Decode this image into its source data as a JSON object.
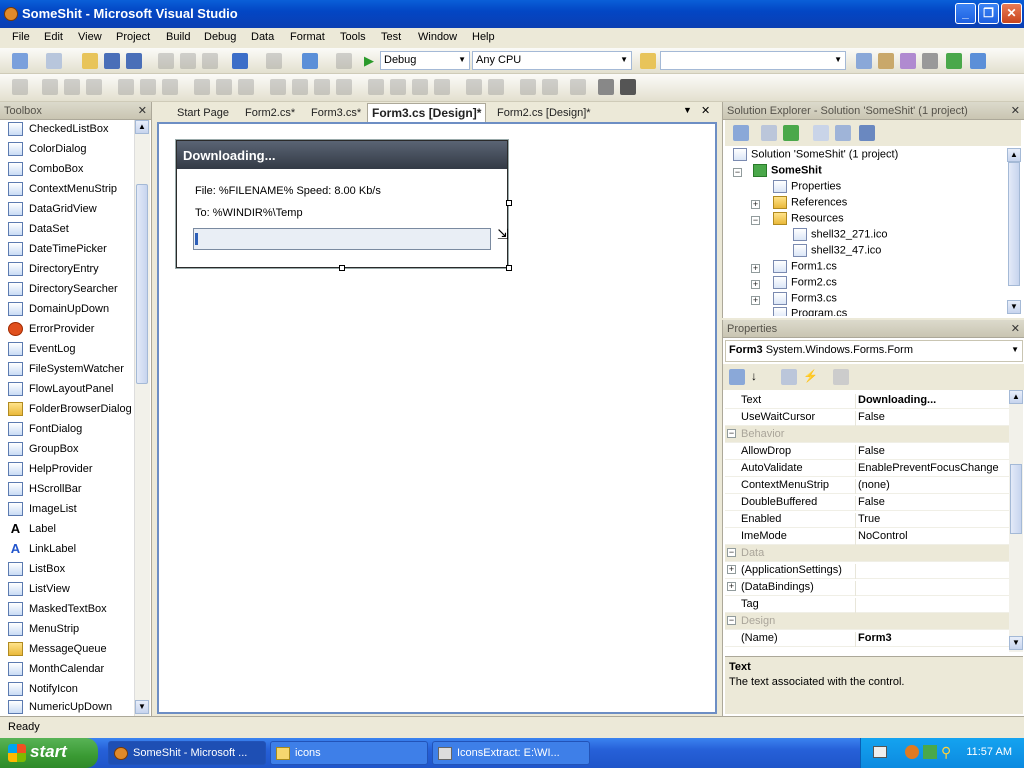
{
  "window": {
    "title": "SomeShit - Microsoft Visual Studio",
    "min": "_",
    "max": "❐",
    "close": "✕"
  },
  "menu": [
    "File",
    "Edit",
    "View",
    "Project",
    "Build",
    "Debug",
    "Data",
    "Format",
    "Tools",
    "Test",
    "Window",
    "Help"
  ],
  "toolbar": {
    "config": "Debug",
    "platform": "Any CPU"
  },
  "toolbox": {
    "title": "Toolbox",
    "items": [
      "CheckedListBox",
      "ColorDialog",
      "ComboBox",
      "ContextMenuStrip",
      "DataGridView",
      "DataSet",
      "DateTimePicker",
      "DirectoryEntry",
      "DirectorySearcher",
      "DomainUpDown",
      "ErrorProvider",
      "EventLog",
      "FileSystemWatcher",
      "FlowLayoutPanel",
      "FolderBrowserDialog",
      "FontDialog",
      "GroupBox",
      "HelpProvider",
      "HScrollBar",
      "ImageList",
      "Label",
      "LinkLabel",
      "ListBox",
      "ListView",
      "MaskedTextBox",
      "MenuStrip",
      "MessageQueue",
      "MonthCalendar",
      "NotifyIcon",
      "NumericUpDown"
    ]
  },
  "tabs": [
    "Start Page",
    "Form2.cs*",
    "Form3.cs*",
    "Form3.cs [Design]*",
    "Form2.cs [Design]*"
  ],
  "form": {
    "title": "Downloading...",
    "file_line": "File: %FILENAME%    Speed: 8.00 Kb/s",
    "to_line": "To: %WINDIR%\\Temp",
    "progress": 0.01
  },
  "solution_explorer": {
    "title": "Solution Explorer - Solution 'SomeShit' (1 project)",
    "solution": "Solution 'SomeShit' (1 project)",
    "project": "SomeShit",
    "nodes": [
      "Properties",
      "References",
      "Resources",
      "shell32_271.ico",
      "shell32_47.ico",
      "Form1.cs",
      "Form2.cs",
      "Form3.cs",
      "Program.cs"
    ]
  },
  "properties": {
    "title": "Properties",
    "object": "Form3",
    "object_type": "System.Windows.Forms.Form",
    "rows": [
      {
        "name": "Text",
        "value": "Downloading..."
      },
      {
        "name": "UseWaitCursor",
        "value": "False"
      },
      {
        "name": "Behavior",
        "value": ""
      },
      {
        "name": "AllowDrop",
        "value": "False"
      },
      {
        "name": "AutoValidate",
        "value": "EnablePreventFocusChange"
      },
      {
        "name": "ContextMenuStrip",
        "value": "(none)"
      },
      {
        "name": "DoubleBuffered",
        "value": "False"
      },
      {
        "name": "Enabled",
        "value": "True"
      },
      {
        "name": "ImeMode",
        "value": "NoControl"
      },
      {
        "name": "Data",
        "value": ""
      },
      {
        "name": "(ApplicationSettings)",
        "value": ""
      },
      {
        "name": "(DataBindings)",
        "value": ""
      },
      {
        "name": "Tag",
        "value": ""
      },
      {
        "name": "Design",
        "value": ""
      },
      {
        "name": "(Name)",
        "value": "Form3"
      }
    ],
    "desc_title": "Text",
    "desc_text": "The text associated with the control."
  },
  "status": "Ready",
  "taskbar": {
    "start": "start",
    "tasks": [
      "SomeShit - Microsoft ...",
      "icons",
      "IconsExtract:  E:\\WI..."
    ],
    "clock": "11:57 AM"
  }
}
